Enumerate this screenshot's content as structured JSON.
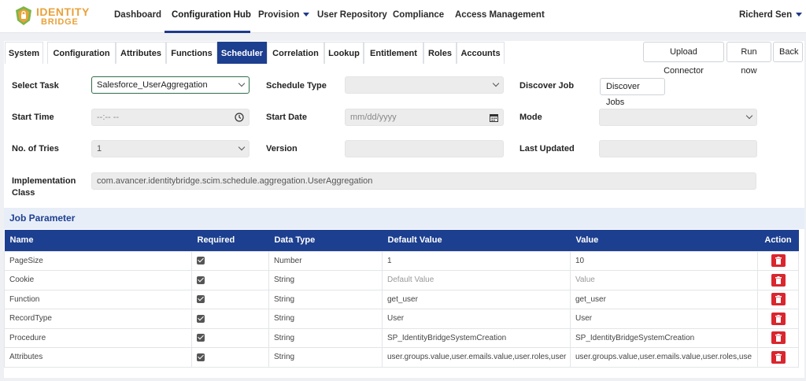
{
  "brand": {
    "line1": "IDENTITY",
    "line2": "BRIDGE"
  },
  "nav": {
    "dashboard": "Dashboard",
    "configuration_hub": "Configuration Hub",
    "provision": "Provision",
    "user_repository": "User Repository",
    "compliance": "Compliance",
    "access_management": "Access Management",
    "user": "Richerd Sen"
  },
  "tabs": [
    "System",
    "Configuration",
    "Attributes",
    "Functions",
    "Scheduler",
    "Correlation",
    "Lookup",
    "Entitlement",
    "Roles",
    "Accounts"
  ],
  "actions": {
    "upload": "Upload Connector",
    "run": "Run now",
    "back": "Back"
  },
  "form": {
    "select_task_label": "Select Task",
    "select_task_value": "Salesforce_UserAggregation",
    "schedule_type_label": "Schedule Type",
    "schedule_type_value": "",
    "discover_job_label": "Discover Job",
    "discover_jobs_button": "Discover Jobs",
    "start_time_label": "Start Time",
    "start_time_placeholder": "--:-- --",
    "start_date_label": "Start Date",
    "start_date_placeholder": "mm/dd/yyyy",
    "mode_label": "Mode",
    "mode_value": "",
    "tries_label": "No. of Tries",
    "tries_value": "1",
    "version_label": "Version",
    "version_value": "",
    "last_updated_label": "Last Updated",
    "last_updated_value": "",
    "impl_label_1": "Implementation",
    "impl_label_2": "Class",
    "impl_value": "com.avancer.identitybridge.scim.schedule.aggregation.UserAggregation"
  },
  "job_parameter": {
    "title": "Job Parameter",
    "columns": {
      "name": "Name",
      "required": "Required",
      "data_type": "Data Type",
      "default_value": "Default Value",
      "value": "Value",
      "action": "Action"
    },
    "rows": [
      {
        "name": "PageSize",
        "required": true,
        "data_type": "Number",
        "default_value": "1",
        "value": "10"
      },
      {
        "name": "Cookie",
        "required": true,
        "data_type": "String",
        "default_value": "Default Value",
        "value": "Value",
        "placeholder": true
      },
      {
        "name": "Function",
        "required": true,
        "data_type": "String",
        "default_value": "get_user",
        "value": "get_user"
      },
      {
        "name": "RecordType",
        "required": true,
        "data_type": "String",
        "default_value": "User",
        "value": "User"
      },
      {
        "name": "Procedure",
        "required": true,
        "data_type": "String",
        "default_value": "SP_IdentityBridgeSystemCreation",
        "value": "SP_IdentityBridgeSystemCreation"
      },
      {
        "name": "Attributes",
        "required": true,
        "data_type": "String",
        "default_value": "user.groups.value,user.emails.value,user.roles,user",
        "value": "user.groups.value,user.emails.value,user.roles,use"
      }
    ]
  },
  "colors": {
    "primary": "#1d3f8f",
    "danger": "#d9262f",
    "brand": "#e8a23a"
  }
}
